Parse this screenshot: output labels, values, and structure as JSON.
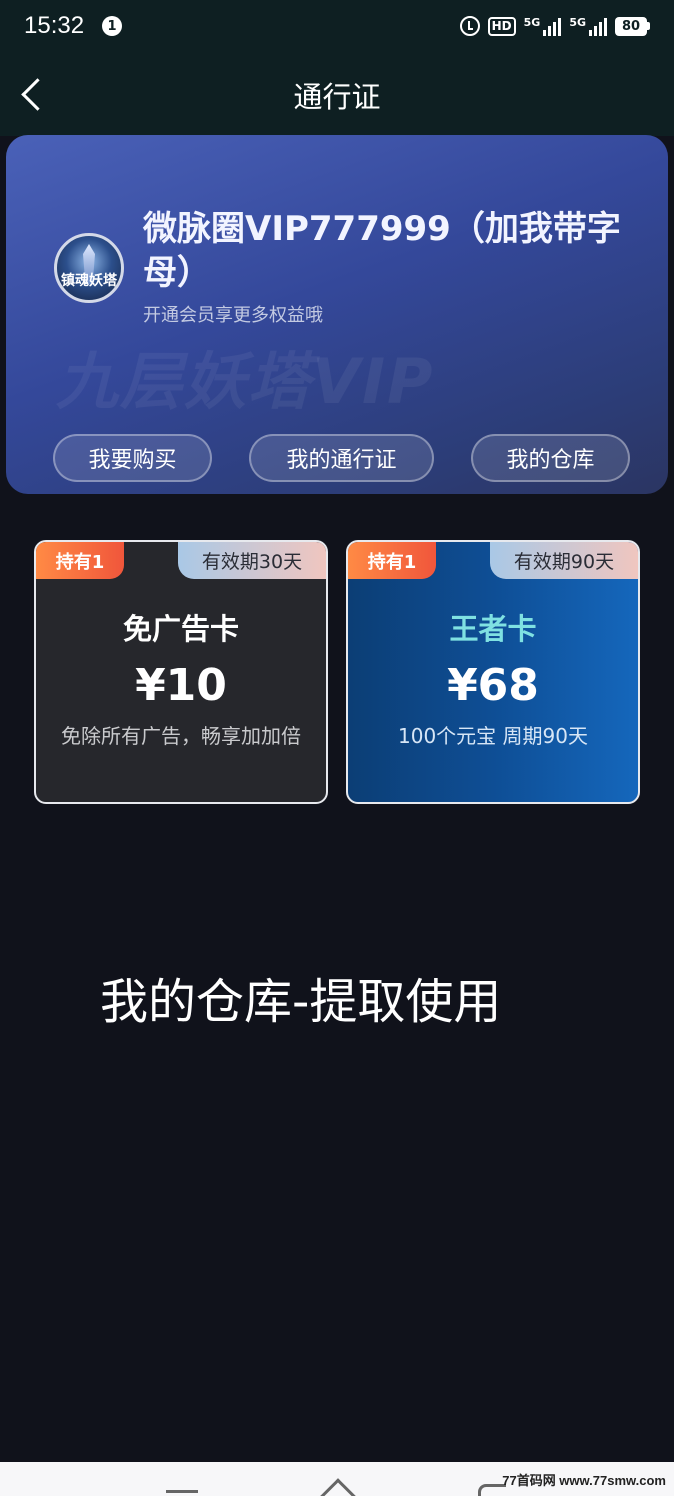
{
  "status_bar": {
    "time": "15:32",
    "notification_count": "1",
    "hd_label": "HD",
    "signal_1": "5G",
    "signal_2": "5G",
    "battery": "80"
  },
  "nav": {
    "title": "通行证"
  },
  "hero": {
    "avatar_text": "镇魂妖塔",
    "user_name": "微脉圈VIP777999（加我带字母）",
    "subtitle": "开通会员享更多权益哦",
    "watermark": "九层妖塔VIP",
    "buttons": {
      "buy": "我要购买",
      "my_pass": "我的通行证",
      "warehouse": "我的仓库"
    }
  },
  "cards": [
    {
      "held": "持有1",
      "validity": "有效期30天",
      "name": "免广告卡",
      "price": "¥10",
      "desc": "免除所有广告，畅享加加倍"
    },
    {
      "held": "持有1",
      "validity": "有效期90天",
      "name": "王者卡",
      "price": "¥68",
      "desc": "100个元宝 周期90天"
    }
  ],
  "caption": "我的仓库-提取使用",
  "footer": {
    "watermark": "77首码网 www.77smw.com"
  },
  "colors": {
    "page_bg": "#10121b",
    "header_bg": "#0e1f22",
    "hero_gradient_start": "#4a61b8",
    "badge_orange": "#f0563b",
    "king_card_name": "#7fe1e2"
  }
}
